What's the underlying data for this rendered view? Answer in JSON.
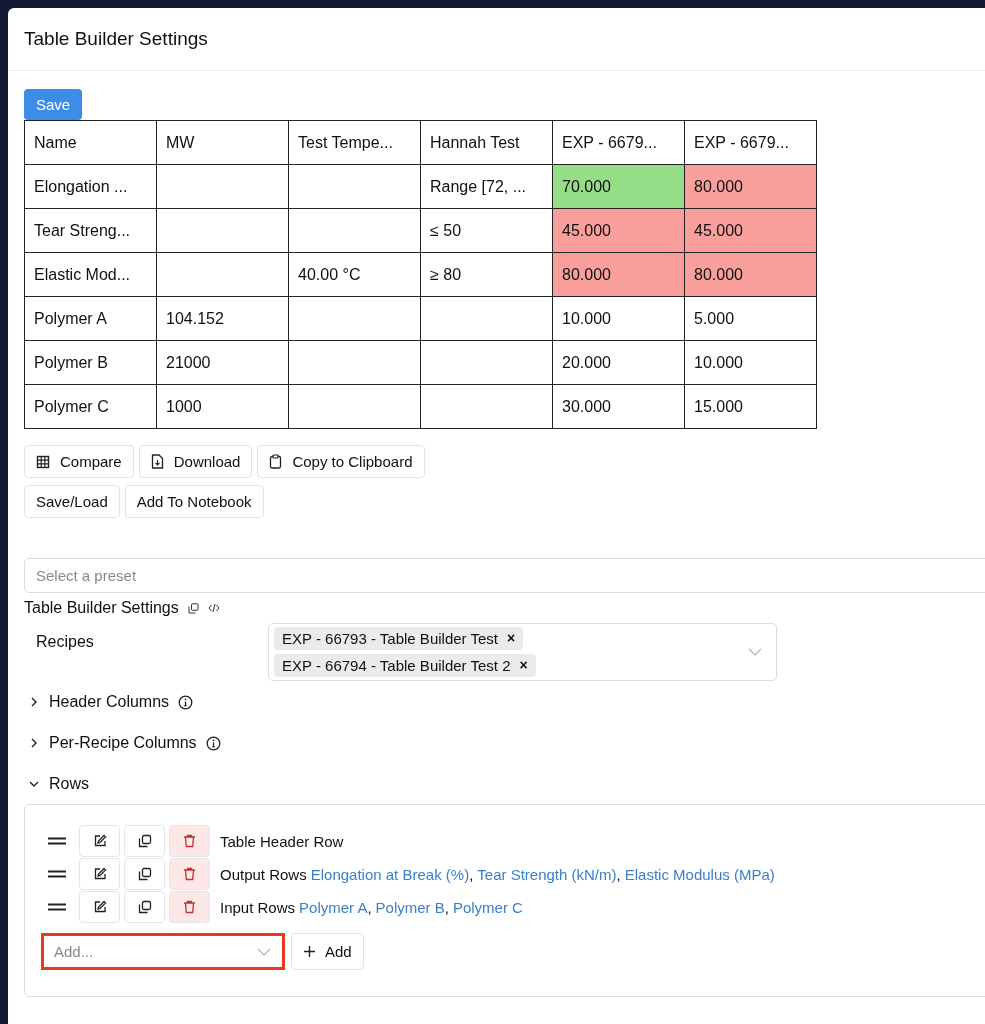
{
  "modal": {
    "title": "Table Builder Settings"
  },
  "save_button": "Save",
  "table": {
    "columns": [
      "Name",
      "MW",
      "Test Tempe...",
      "Hannah Test",
      "EXP - 6679...",
      "EXP - 6679..."
    ],
    "rows": [
      {
        "cells": [
          {
            "text": "Elongation ..."
          },
          {
            "text": ""
          },
          {
            "text": ""
          },
          {
            "text": "Range [72, ..."
          },
          {
            "text": "70.000",
            "color": "#96dd87"
          },
          {
            "text": "80.000",
            "color": "#f9a09c"
          }
        ]
      },
      {
        "cells": [
          {
            "text": "Tear Streng..."
          },
          {
            "text": ""
          },
          {
            "text": ""
          },
          {
            "text": "≤ 50"
          },
          {
            "text": "45.000",
            "color": "#f9a09c"
          },
          {
            "text": "45.000",
            "color": "#f9a09c"
          }
        ]
      },
      {
        "cells": [
          {
            "text": "Elastic Mod..."
          },
          {
            "text": ""
          },
          {
            "text": "40.00 °C"
          },
          {
            "text": "≥ 80"
          },
          {
            "text": "80.000",
            "color": "#f9a09c"
          },
          {
            "text": "80.000",
            "color": "#f9a09c"
          }
        ]
      },
      {
        "cells": [
          {
            "text": "Polymer A"
          },
          {
            "text": "104.152"
          },
          {
            "text": ""
          },
          {
            "text": ""
          },
          {
            "text": "10.000"
          },
          {
            "text": "5.000"
          }
        ]
      },
      {
        "cells": [
          {
            "text": "Polymer B"
          },
          {
            "text": "21000"
          },
          {
            "text": ""
          },
          {
            "text": ""
          },
          {
            "text": "20.000"
          },
          {
            "text": "10.000"
          }
        ]
      },
      {
        "cells": [
          {
            "text": "Polymer C"
          },
          {
            "text": "1000"
          },
          {
            "text": ""
          },
          {
            "text": ""
          },
          {
            "text": "30.000"
          },
          {
            "text": "15.000"
          }
        ]
      }
    ]
  },
  "actions": [
    [
      "Compare",
      "Download",
      "Copy to Clipboard"
    ],
    [
      "Save/Load",
      "Add To Notebook"
    ]
  ],
  "preset": {
    "placeholder": "Select a preset"
  },
  "settings_title": "Table Builder Settings",
  "recipes": {
    "label": "Recipes",
    "tags": [
      {
        "label": "EXP - 66793 - Table Builder Test",
        "remove": "×"
      },
      {
        "label": "EXP - 66794 - Table Builder Test 2",
        "remove": "×"
      }
    ]
  },
  "sections": [
    {
      "label": "Header Columns",
      "expanded": false,
      "info": true
    },
    {
      "label": "Per-Recipe Columns",
      "expanded": false,
      "info": true
    },
    {
      "label": "Rows",
      "expanded": true,
      "info": false
    }
  ],
  "rows_list": [
    {
      "label": "Table Header Row"
    },
    {
      "label": "Output Rows",
      "links": [
        "Elongation at Break (%)",
        "Tear Strength (kN/m)",
        "Elastic Modulus (MPa)"
      ],
      "separator": ","
    },
    {
      "label": "Input Rows",
      "links": [
        "Polymer A",
        "Polymer B",
        "Polymer C"
      ],
      "separator": ","
    }
  ],
  "add_field": {
    "placeholder": "Add...",
    "highlighted": true
  },
  "add_button": "Add"
}
